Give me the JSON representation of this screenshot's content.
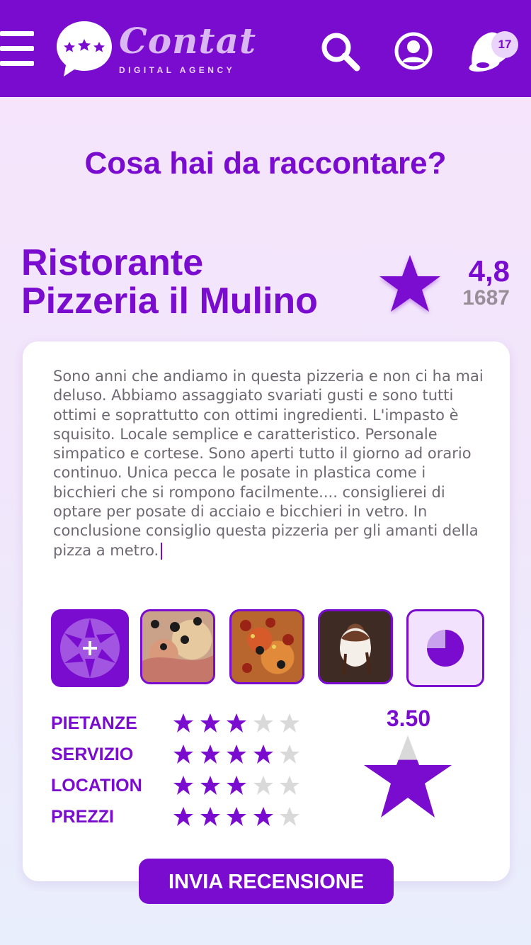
{
  "header": {
    "logo_word": "Contat",
    "logo_sub": "DIGITAL AGENCY",
    "notification_count": "17"
  },
  "page": {
    "headline": "Cosa hai da raccontare?"
  },
  "place": {
    "name_line1": "Ristorante",
    "name_line2": "Pizzeria il Mulino",
    "rating": "4,8",
    "review_count": "1687"
  },
  "review": {
    "text": "Sono anni che andiamo in questa pizzeria e non ci ha mai deluso. Abbiamo assaggiato svariati gusti e sono tutti ottimi e soprattutto con ottimi ingredienti. L'impasto è squisito. Locale semplice e caratteristico. Personale simpatico e cortese. Sono aperti tutto il giorno ad orario continuo. Unica pecca le posate in plastica come i bicchieri che si rompono facilmente.... consiglierei di optare per posate di acciaio e bicchieri in vetro. In conclusione consiglio questa pizzeria per gli amanti della pizza a metro."
  },
  "ratings": [
    {
      "label": "PIETANZE",
      "stars": 3
    },
    {
      "label": "SERVIZIO",
      "stars": 4
    },
    {
      "label": "LOCATION",
      "stars": 3
    },
    {
      "label": "PREZZI",
      "stars": 4
    }
  ],
  "average": {
    "value": "3.50",
    "fill_fraction": 0.7
  },
  "actions": {
    "submit_label": "INVIA RECENSIONE"
  },
  "colors": {
    "accent": "#7a0ccf",
    "star_empty": "#d9d9d9"
  }
}
